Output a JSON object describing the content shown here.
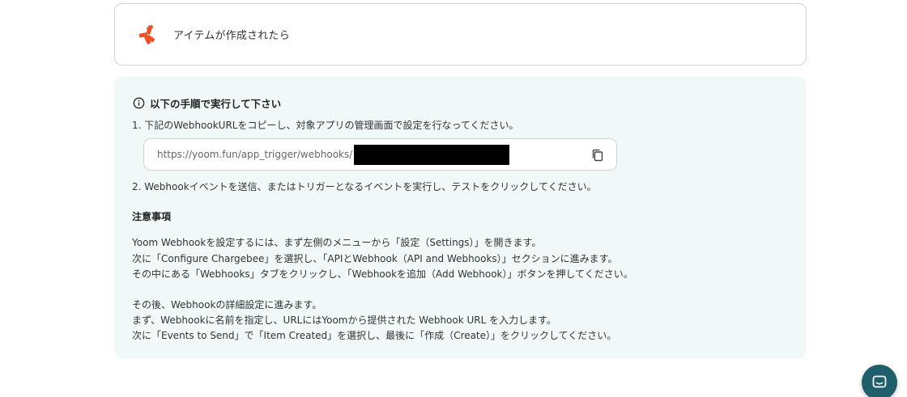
{
  "trigger": {
    "logo_icon": "yoom-asterisk-logo-icon",
    "title": "アイテムが作成されたら",
    "logo_color": "#f04e23"
  },
  "instructions": {
    "heading_icon": "info-circle-icon",
    "heading": "以下の手順で実行して下さい",
    "step1": "1. 下記のWebhookURLをコピーし、対象アプリの管理画面で設定を行なってください。",
    "webhook_url": "https://yoom.fun/app_trigger/webhooks/",
    "copy_icon": "copy-icon",
    "step2": "2. Webhookイベントを送信、またはトリガーとなるイベントを実行し、テストをクリックしてください。"
  },
  "notes": {
    "heading": "注意事項",
    "lines": [
      "Yoom Webhookを設定するには、まず左側のメニューから「設定（Settings）」を開きます。",
      "次に「Configure Chargebee」を選択し、「APIとWebhook（API and Webhooks）」セクションに進みます。",
      "その中にある「Webhooks」タブをクリックし、「Webhookを追加（Add Webhook）」ボタンを押してください。",
      "その後、Webhookの詳細設定に進みます。",
      "まず、Webhookに名前を指定し、URLにはYoomから提供された Webhook URL を入力します。",
      "次に「Events to Send」で「Item Created」を選択し、最後に「作成（Create）」をクリックしてください。"
    ]
  },
  "chat": {
    "icon": "chat-bubble-icon",
    "color": "#1f5f6b"
  }
}
